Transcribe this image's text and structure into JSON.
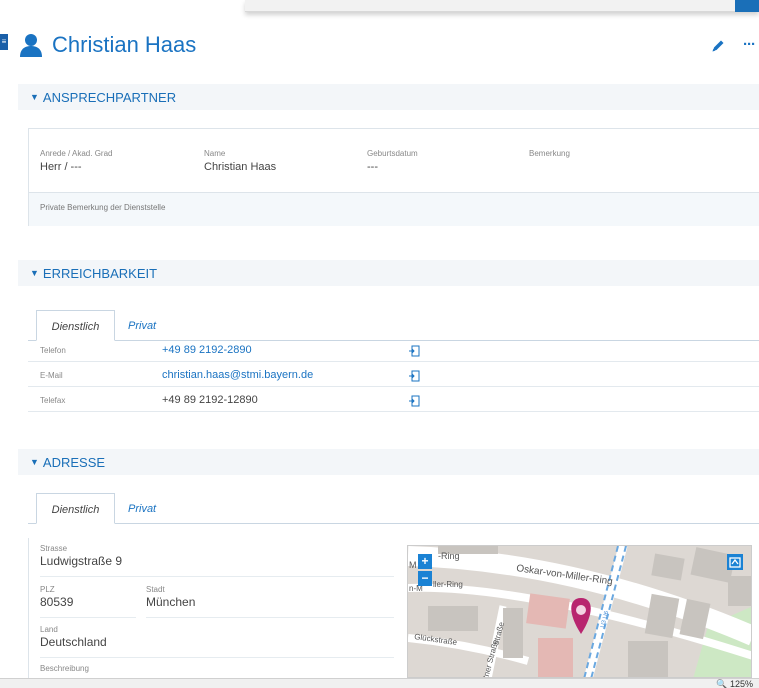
{
  "header": {
    "name": "Christian Haas",
    "icons": {
      "person": "person-icon",
      "edit": "pencil-icon",
      "more": "more-horizontal-icon"
    },
    "accent_color": "#1a73c2"
  },
  "sidebar_handle": {
    "glyph": "≡"
  },
  "sections": {
    "ansprechpartner": "ANSPRECHPARTNER",
    "erreichbarkeit": "ERREICHBARKEIT",
    "adresse": "ADRESSE"
  },
  "ansprechpartner": {
    "fields": [
      {
        "label": "Anrede / Akad. Grad",
        "value": "Herr / ---"
      },
      {
        "label": "Name",
        "value": "Christian Haas"
      },
      {
        "label": "Geburtsdatum",
        "value": "---"
      },
      {
        "label": "Bemerkung",
        "value": ""
      }
    ],
    "private_note_label": "Private Bemerkung der Dienststelle"
  },
  "erreichbarkeit": {
    "tabs": [
      "Dienstlich",
      "Privat"
    ],
    "rows": [
      {
        "label": "Telefon",
        "value": "+49 89 2192-2890",
        "link": true
      },
      {
        "label": "E-Mail",
        "value": "christian.haas@stmi.bayern.de",
        "link": true
      },
      {
        "label": "Telefax",
        "value": "+49 89 2192-12890",
        "link": false
      }
    ]
  },
  "adresse": {
    "tabs": [
      "Dienstlich",
      "Privat"
    ],
    "strasse": {
      "label": "Strasse",
      "value": "Ludwigstraße 9"
    },
    "plz": {
      "label": "PLZ",
      "value": "80539"
    },
    "stadt": {
      "label": "Stadt",
      "value": "München"
    },
    "land": {
      "label": "Land",
      "value": "Deutschland"
    },
    "beschreibung": {
      "label": "Beschreibung",
      "value": ""
    },
    "map": {
      "zoom_in": "+",
      "zoom_out": "−",
      "streets": [
        "Oskar-von-Miller-Ring",
        "M",
        "-Ring",
        "n-M",
        "ller-Ring",
        "Glückstraße",
        "Straße",
        "tner Straße",
        "U3 U6"
      ],
      "marker_color": "#b8256f"
    }
  },
  "status": {
    "zoom": "125%"
  }
}
